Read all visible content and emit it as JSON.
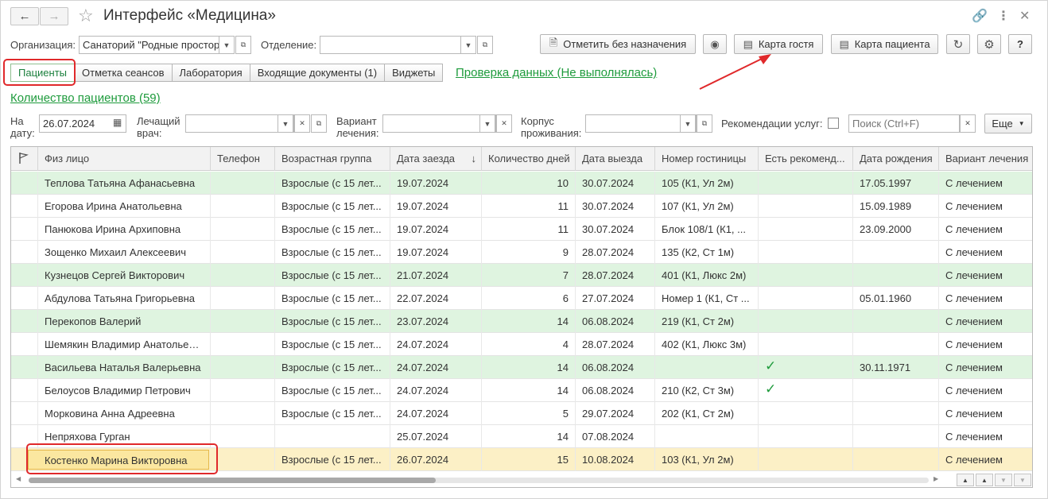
{
  "window": {
    "title": "Интерфейс «Медицина»",
    "back_icon": "arrow-left-icon",
    "forward_icon": "arrow-right-icon",
    "favorite_icon": "star-icon",
    "link_icon": "link-icon",
    "menu_icon": "more-vertical-icon",
    "close_icon": "close-icon"
  },
  "filters": {
    "organization_label": "Организация:",
    "organization_value": "Санаторий \"Родные простор",
    "department_label": "Отделение:",
    "department_value": "",
    "date_label_1": "На",
    "date_label_2": "дату:",
    "date_value": "26.07.2024",
    "doctor_label_1": "Лечащий",
    "doctor_label_2": "врач:",
    "doctor_value": "",
    "treatment_label_1": "Вариант",
    "treatment_label_2": "лечения:",
    "treatment_value": "",
    "building_label_1": "Корпус",
    "building_label_2": "проживания:",
    "building_value": "",
    "recommendations_label": "Рекомендации услуг:",
    "search_placeholder": "Поиск (Ctrl+F)",
    "more_label": "Еще"
  },
  "toolbar": {
    "mark_without_label": "Отметить без назначения",
    "guest_card_label": "Карта гостя",
    "patient_card_label": "Карта пациента",
    "help_label": "?"
  },
  "tabs": [
    {
      "label": "Пациенты",
      "active": true
    },
    {
      "label": "Отметка сеансов"
    },
    {
      "label": "Лаборатория"
    },
    {
      "label": "Входящие документы (1)"
    },
    {
      "label": "Виджеты"
    }
  ],
  "links": {
    "data_check": "Проверка данных (Не выполнялась)",
    "patient_count": "Количество пациентов (59)"
  },
  "table": {
    "columns": [
      "Физ лицо",
      "Телефон",
      "Возрастная группа",
      "Дата заезда",
      "Количество дней",
      "Дата выезда",
      "Номер гостиницы",
      "Есть рекоменд...",
      "Дата рождения",
      "Вариант лечения"
    ],
    "sort_indicator": "↓",
    "rows": [
      {
        "style": "green",
        "name": "Теплова Татьяна Афанасьевна",
        "phone": "",
        "age": "Взрослые (с 15 лет...",
        "arrival": "19.07.2024",
        "days": "10",
        "departure": "30.07.2024",
        "room": "105 (К1, Ул 2м)",
        "rec": false,
        "birth": "17.05.1997",
        "treatment": "С лечением"
      },
      {
        "style": "white",
        "name": "Егорова Ирина Анатольевна",
        "phone": "",
        "age": "Взрослые (с 15 лет...",
        "arrival": "19.07.2024",
        "days": "11",
        "departure": "30.07.2024",
        "room": "107 (К1, Ул 2м)",
        "rec": false,
        "birth": "15.09.1989",
        "treatment": "С лечением"
      },
      {
        "style": "white",
        "name": "Панюкова Ирина Архиповна",
        "phone": "",
        "age": "Взрослые (с 15 лет...",
        "arrival": "19.07.2024",
        "days": "11",
        "departure": "30.07.2024",
        "room": "Блок 108/1 (К1, ...",
        "rec": false,
        "birth": "23.09.2000",
        "treatment": "С лечением"
      },
      {
        "style": "white",
        "name": "Зощенко Михаил Алексеевич",
        "phone": "",
        "age": "Взрослые (с 15 лет...",
        "arrival": "19.07.2024",
        "days": "9",
        "departure": "28.07.2024",
        "room": "135 (К2, Ст 1м)",
        "rec": false,
        "birth": "",
        "treatment": "С лечением"
      },
      {
        "style": "green",
        "name": "Кузнецов Сергей Викторович",
        "phone": "",
        "age": "Взрослые (с 15 лет...",
        "arrival": "21.07.2024",
        "days": "7",
        "departure": "28.07.2024",
        "room": "401 (К1, Люкс 2м)",
        "rec": false,
        "birth": "",
        "treatment": "С лечением"
      },
      {
        "style": "white",
        "name": "Абдулова Татьяна Григорьевна",
        "phone": "",
        "age": "Взрослые (с 15 лет...",
        "arrival": "22.07.2024",
        "days": "6",
        "departure": "27.07.2024",
        "room": "Номер 1 (К1, Ст ...",
        "rec": false,
        "birth": "05.01.1960",
        "treatment": "С лечением"
      },
      {
        "style": "green",
        "name": "Перекопов Валерий",
        "phone": "",
        "age": "Взрослые (с 15 лет...",
        "arrival": "23.07.2024",
        "days": "14",
        "departure": "06.08.2024",
        "room": "219 (К1, Ст 2м)",
        "rec": false,
        "birth": "",
        "treatment": "С лечением"
      },
      {
        "style": "white",
        "name": "Шемякин Владимир Анатольевич",
        "phone": "",
        "age": "Взрослые (с 15 лет...",
        "arrival": "24.07.2024",
        "days": "4",
        "departure": "28.07.2024",
        "room": "402 (К1, Люкс 3м)",
        "rec": false,
        "birth": "",
        "treatment": "С лечением"
      },
      {
        "style": "green",
        "name": "Васильева Наталья Валерьевна",
        "phone": "",
        "age": "Взрослые (с 15 лет...",
        "arrival": "24.07.2024",
        "days": "14",
        "departure": "06.08.2024",
        "room": "",
        "rec": true,
        "birth": "30.11.1971",
        "treatment": "С лечением"
      },
      {
        "style": "white",
        "name": "Белоусов Владимир Петрович",
        "phone": "",
        "age": "Взрослые (с 15 лет...",
        "arrival": "24.07.2024",
        "days": "14",
        "departure": "06.08.2024",
        "room": "210 (К2, Ст 3м)",
        "rec": true,
        "birth": "",
        "treatment": "С лечением"
      },
      {
        "style": "white",
        "name": "Морковина Анна Адреевна",
        "phone": "",
        "age": "Взрослые (с 15 лет...",
        "arrival": "24.07.2024",
        "days": "5",
        "departure": "29.07.2024",
        "room": "202 (К1, Ст 2м)",
        "rec": false,
        "birth": "",
        "treatment": "С лечением"
      },
      {
        "style": "white",
        "name": "Непряхова Гурган",
        "phone": "",
        "age": "",
        "arrival": "25.07.2024",
        "days": "14",
        "departure": "07.08.2024",
        "room": "",
        "rec": false,
        "birth": "",
        "treatment": "С лечением"
      },
      {
        "style": "sel",
        "name": "Костенко Марина Викторовна",
        "phone": "",
        "age": "Взрослые (с 15 лет...",
        "arrival": "26.07.2024",
        "days": "15",
        "departure": "10.08.2024",
        "room": "103 (К1, Ул 2м)",
        "rec": false,
        "birth": "",
        "treatment": "С лечением"
      }
    ]
  },
  "colors": {
    "accent_green": "#1e9b3c",
    "row_green": "#dff4e0",
    "row_selected": "#fcf0c6",
    "highlight_red": "#e0292b"
  }
}
